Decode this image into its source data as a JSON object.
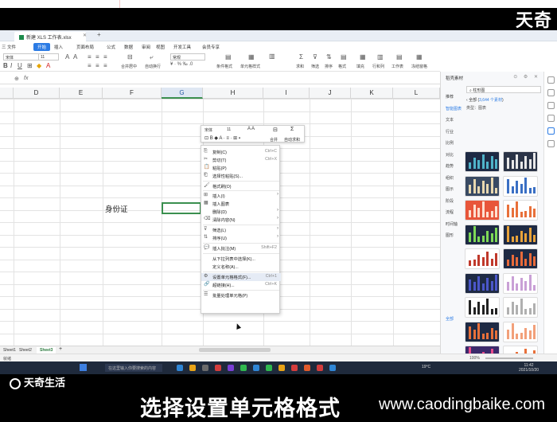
{
  "watermark_top": "天奇",
  "watermark_bottom": "天奇生活",
  "caption": "选择设置单元格格式",
  "site": "www.caodingbaike.com",
  "window": {
    "doc_tab": "新建 XLS 工作表.xlsx",
    "menu": [
      "三 文件",
      "开始",
      "插入",
      "页面布局",
      "公式",
      "数据",
      "审阅",
      "视图",
      "开发工具",
      "会员专享"
    ]
  },
  "ribbon": {
    "font": "宋体",
    "size": "11",
    "numfmt": "常规",
    "labels": [
      "合并居中",
      "自动换行",
      "条件格式",
      "单元格样式",
      "求和",
      "筛选",
      "排序",
      "格式",
      "填充",
      "行和列",
      "工作表",
      "冻结窗格",
      "表格工具",
      "查找",
      "符号"
    ]
  },
  "formula_bar": {
    "zoom": "⊕",
    "fx": "fx"
  },
  "columns": [
    "D",
    "E",
    "F",
    "G",
    "H",
    "I",
    "J",
    "K",
    "L"
  ],
  "cell_text": "身份证",
  "mini_toolbar": {
    "font": "宋体",
    "size": "11",
    "merge": "合并",
    "autosum": "自动求和"
  },
  "context_menu": [
    {
      "icon": "copy-icon",
      "glyph": "⎘",
      "label": "复制(C)",
      "shortcut": "Ctrl+C"
    },
    {
      "icon": "cut-icon",
      "glyph": "✂",
      "label": "剪切(T)",
      "shortcut": "Ctrl+X"
    },
    {
      "icon": "paste-icon",
      "glyph": "📋",
      "label": "粘贴(P)",
      "shortcut": ""
    },
    {
      "icon": "paste-special-icon",
      "glyph": "⎗",
      "label": "选择性粘贴(S)...",
      "shortcut": ""
    },
    {
      "icon": "format-painter-icon",
      "glyph": "🖌",
      "label": "格式刷(O)",
      "shortcut": ""
    },
    {
      "icon": "insert-icon",
      "glyph": "⊞",
      "label": "插入(I)",
      "shortcut": ""
    },
    {
      "icon": "insert-table-icon",
      "glyph": "▦",
      "label": "插入图表",
      "shortcut": ""
    },
    {
      "icon": "",
      "glyph": "",
      "label": "删除(D)",
      "shortcut": ""
    },
    {
      "icon": "clear-icon",
      "glyph": "⌫",
      "label": "清除内容(N)",
      "shortcut": ""
    },
    {
      "icon": "filter-icon",
      "glyph": "⊽",
      "label": "筛选(L)",
      "shortcut": ""
    },
    {
      "icon": "sort-icon",
      "glyph": "⇅",
      "label": "排序(U)",
      "shortcut": ""
    },
    {
      "icon": "comment-icon",
      "glyph": "💬",
      "label": "插入批注(M)",
      "shortcut": "Shift+F2"
    },
    {
      "icon": "",
      "glyph": "",
      "label": "从下拉列表中选择(K)...",
      "shortcut": ""
    },
    {
      "icon": "",
      "glyph": "",
      "label": "定义名称(A)...",
      "shortcut": ""
    },
    {
      "icon": "format-cells-icon",
      "glyph": "⚙",
      "label": "设置单元格格式(F)...",
      "shortcut": "Ctrl+1"
    },
    {
      "icon": "hyperlink-icon",
      "glyph": "🔗",
      "label": "超链接(H)...",
      "shortcut": "Ctrl+K"
    },
    {
      "icon": "batch-icon",
      "glyph": "☰",
      "label": "批量处理单元格(P)",
      "shortcut": ""
    }
  ],
  "sheets": [
    "Sheet1",
    "Sheet2",
    "Sheet3"
  ],
  "status": {
    "left": "就绪",
    "zoom": "100%"
  },
  "taskbar": {
    "search": "在这里输入你要搜索的内容",
    "tray": "19°C",
    "time": "11:42",
    "date": "2021/10/20"
  },
  "right_pane": {
    "title": "稻壳素材",
    "search": "柱形图",
    "result_prefix": "全部 (",
    "result_count": "3,644 个素材",
    "result_suffix": ")",
    "type_label": "类型：",
    "type_value": "图表",
    "categories": [
      "推荐",
      "智能图表",
      "文本",
      "行业",
      "比例",
      "对比",
      "趋势",
      "组织",
      "图示",
      "阶段",
      "流程",
      "时间轴",
      "图形"
    ],
    "more_label": "全部",
    "colors": {
      "accent": "#2b7be4",
      "dark": "#1e2a44",
      "orange": "#e8703a"
    }
  }
}
